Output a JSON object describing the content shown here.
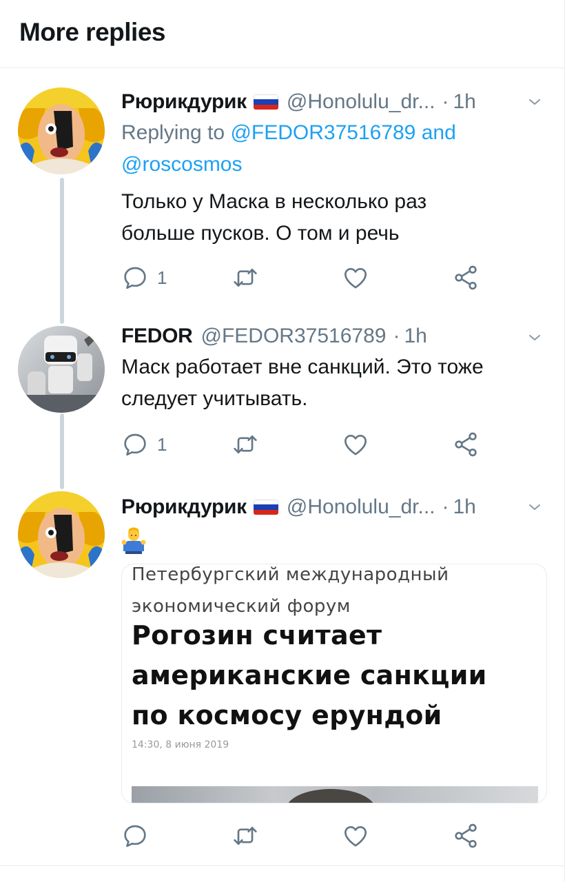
{
  "header": {
    "title": "More replies"
  },
  "tweets": [
    {
      "name": "Рюрикдурик",
      "handle": "@Honolulu_dr...",
      "dot": "·",
      "time": "1h",
      "replying_label": "Replying to ",
      "replying_to_1": "@FEDOR37516789",
      "replying_and": " and",
      "replying_to_2": "@roscosmos",
      "text_line1": "Только у Маска в несколько раз",
      "text_line2": "больше пусков. О том и речь",
      "reply_count": "1",
      "flag_colors": [
        "#ffffff",
        "#1c3fb4",
        "#d62718"
      ]
    },
    {
      "name": "FEDOR",
      "handle": "@FEDOR37516789",
      "dot": "·",
      "time": "1h",
      "text_line1": "Маск работает вне санкций. Это тоже",
      "text_line2": "следует учитывать.",
      "reply_count": "1"
    },
    {
      "name": "Рюрикдурик",
      "handle": "@Honolulu_dr...",
      "dot": "·",
      "time": "1h",
      "emoji": "man-shrugging-icon",
      "card": {
        "category_line1": "Петербургский международный",
        "category_line2": "экономический форум",
        "headline_line1": "Рогозин считает",
        "headline_line2": "американские санкции",
        "headline_line3": "по космосу ерундой",
        "date": "14:30, 8 июня 2019"
      }
    }
  ],
  "icons": {
    "reply": "reply-icon",
    "retweet": "retweet-icon",
    "like": "heart-icon",
    "share": "share-icon",
    "caret": "chevron-down-icon"
  },
  "colors": {
    "accent": "#1da1f2",
    "secondary_text": "#657786",
    "thread_line": "#ccd6dd",
    "icon": "#657786"
  }
}
